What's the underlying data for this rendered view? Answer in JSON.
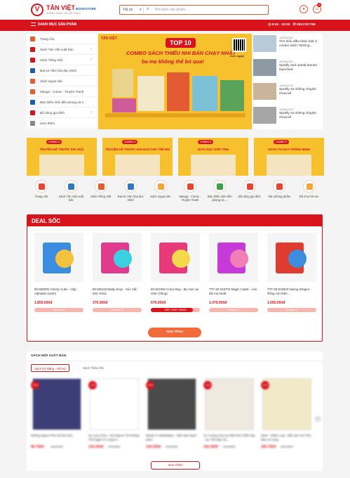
{
  "header": {
    "logo_mark": "V",
    "brand": "TÂN VIỆT",
    "brand_suffix": "BOOKSTORE",
    "tagline": "KHÔNG GIAN CỦA TRI THỨC",
    "search_category": "Tất cả",
    "search_placeholder": "Tìm kiếm sản phẩm...",
    "cart_count": "0"
  },
  "navbar": {
    "menu_label": "DANH MỤC SẢN PHẨM",
    "hours": "8:00 - 20:00",
    "phone": "0812757799"
  },
  "sidebar": {
    "items": [
      {
        "label": "Trang chủ",
        "icon": "home-icon",
        "color": "#e45d2b",
        "chev": ""
      },
      {
        "label": "Sách Tân Việt xuất bản",
        "icon": "book-icon",
        "color": "#d8131c",
        "chev": "›"
      },
      {
        "label": "Sách Tiếng Việt",
        "icon": "book-icon",
        "color": "#d8131c",
        "chev": "›"
      },
      {
        "label": "Đại sứ Văn hóa đọc 2022",
        "icon": "award-icon",
        "color": "#1b5fae",
        "chev": ""
      },
      {
        "label": "Sách ngoại văn",
        "icon": "globe-icon",
        "color": "#e45d2b",
        "chev": ""
      },
      {
        "label": "Manga - Comic - Truyện Tranh",
        "icon": "comic-icon",
        "color": "#e45d2b",
        "chev": ""
      },
      {
        "label": "Bảo thiếu niên tiền phong và n...",
        "icon": "newspaper-icon",
        "color": "#1b5fae",
        "chev": ""
      },
      {
        "label": "Đồ dùng gia đình",
        "icon": "house-icon",
        "color": "#d8131c",
        "chev": "›"
      },
      {
        "label": "Xem thêm",
        "icon": "plus-icon",
        "color": "#888888",
        "chev": ""
      }
    ]
  },
  "banner": {
    "brand": "TÂN VIỆT",
    "badge": "TOP 10",
    "line1": "COMBO SÁCH THIẾU NHI BÁN CHẠY NHẤT",
    "line2": "ba mẹ không thể bỏ qua!",
    "qr_caption": "Xem ngay!"
  },
  "news": [
    {
      "date": "19/08/2022",
      "title": "Tìm hiểu điều khác biệt ở combo sách \"Những..."
    },
    {
      "date": "19/08/2022",
      "title": "Spotify and untold stories launched"
    },
    {
      "date": "19/08/2022",
      "title": "Spotify và những chuyện chưa kể"
    },
    {
      "date": "19/08/2022",
      "title": "Spotify và những chuyện chưa kể"
    }
  ],
  "category_banners": [
    {
      "badge": "COMBO 8",
      "title": "TRUYỆN KỂ TRƯỚC KHI NGỦ"
    },
    {
      "badge": "COMBO 8",
      "title": "TRUYỆN KỂ TRƯỚC KHI NGỦ CHO TRẺ EM"
    },
    {
      "badge": "COMBO 5",
      "title": "GIÁO DỤC GIỚI TÍNH"
    },
    {
      "badge": "COMBO 5",
      "title": "SÁCH TƯ DUY THÔNG MINH"
    }
  ],
  "category_icons": [
    {
      "label": "Trang chủ",
      "icon": "flash-icon",
      "color": "#e8452c"
    },
    {
      "label": "Sách Tân Việt xuất bản",
      "icon": "book-open-icon",
      "color": "#2f79c2"
    },
    {
      "label": "Sách Tiếng Việt",
      "icon": "bookstack-icon",
      "color": "#e45d2b"
    },
    {
      "label": "Đại sứ Văn hóa đọc 2022",
      "icon": "reader-icon",
      "color": "#2f79c2"
    },
    {
      "label": "Sách ngoại văn",
      "icon": "globe-icon",
      "color": "#f2a53a"
    },
    {
      "label": "Manga - Comic - Truyện Tranh",
      "icon": "comic-icon",
      "color": "#e8452c"
    },
    {
      "label": "Báo thiếu niên tiền phong và ...",
      "icon": "pencil-icon",
      "color": "#3aa34a"
    },
    {
      "label": "Đồ dùng gia đình",
      "icon": "family-icon",
      "color": "#e8452c"
    },
    {
      "label": "Văn phòng phẩm",
      "icon": "stationery-icon",
      "color": "#e8452c"
    },
    {
      "label": "Đồ chơi trẻ em",
      "icon": "toy-icon",
      "color": "#f2a53a"
    }
  ],
  "deal": {
    "title": "DEAL SỐC",
    "button": "Xem Thêm",
    "products": [
      {
        "name": "80-505000 Activity Cube - Hộp Alphabet (xanh)",
        "price": "1.855.000đ",
        "status": "Đã bán: 0",
        "sold": 0,
        "c1": "#3b8de0",
        "c2": "#f5c33b"
      },
      {
        "name": "80-505103 Baby Keys - Xúc Xắc Móc Khóa",
        "price": "376.000đ",
        "status": "Đã bán: 0",
        "sold": 0,
        "c1": "#e03b8d",
        "c2": "#3bd0e0"
      },
      {
        "name": "80-522350 Crazy Bug - Bọ cam vui nhộn (hồng)",
        "price": "679.000đ",
        "status": "SẮP CHÁY HÀNG",
        "sold": 85,
        "c1": "#e8397a",
        "c2": "#f6d94a"
      },
      {
        "name": "TTF 80-519703 Magic Castle - Lâu đài ma thuật",
        "price": "1.479.000đ",
        "status": "Đã bán: 0",
        "sold": 0,
        "c1": "#c63bd8",
        "c2": "#f07fb8"
      },
      {
        "name": "TTF 80-519603 Daring Dragon - Rồng con thân...",
        "price": "1.055.000đ",
        "status": "Đã bán: 0",
        "sold": 0,
        "c1": "#e03b2f",
        "c2": "#3b8de0"
      }
    ]
  },
  "new_books": {
    "title": "SÁCH MỚI XUẤT BẢN",
    "tabs": [
      "Sách Kỹ Năng - Hồi Ký",
      "Sách Thiếu Nhi"
    ],
    "button": "Xem Thêm",
    "items": [
      {
        "discount": "-20%",
        "name": "Những Ngươi Phụ Nữ Bé Nhỏ",
        "price": "96.750đ",
        "old": "129.000đ",
        "color": "#3c3e78"
      },
      {
        "discount": "-20%",
        "name": "Sự Lựa Chọn - Nơi Ngươi Tôi Không Thể Ngăn Hi Vọng N...",
        "price": "134.250đ",
        "old": "179.000đ",
        "color": "#ffffff"
      },
      {
        "discount": "-20%",
        "name": "Merlyn ở Manhattan – Một năm hạnh phúc",
        "price": "134.250đ",
        "old": "179.000đ",
        "color": "#4a4a4a"
      },
      {
        "discount": "-20%",
        "name": "Ảo Tưởng Của Sự Bất Khả Chiến Bại - Sự Trỗi Dậy Và...",
        "price": "116.250đ",
        "old": "155.000đ",
        "color": "#efe9df"
      },
      {
        "discount": "-20%",
        "name": "Sách - Nhân Loại - Mối Liên Sử Trên Đảo Hi Vọng",
        "price": "183.750đ",
        "old": "245.000đ",
        "color": "#f2e9c8"
      }
    ]
  }
}
